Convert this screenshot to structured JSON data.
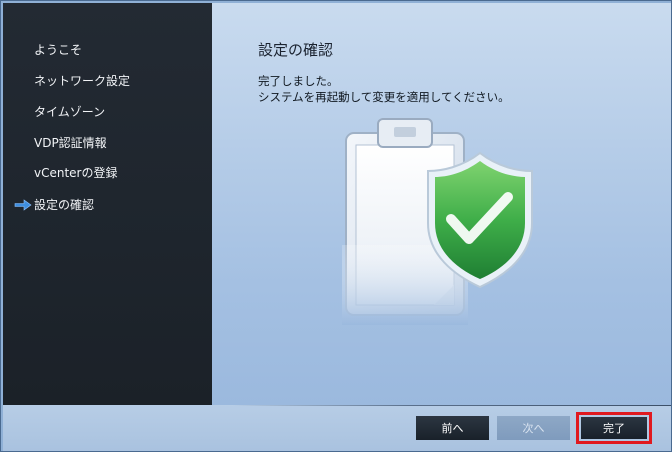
{
  "sidebar": {
    "items": [
      {
        "label": "ようこそ"
      },
      {
        "label": "ネットワーク設定"
      },
      {
        "label": "タイムゾーン"
      },
      {
        "label": "VDP認証情報"
      },
      {
        "label": "vCenterの登録"
      },
      {
        "label": "設定の確認",
        "current": true
      }
    ]
  },
  "main": {
    "title": "設定の確認",
    "message_line1": "完了しました。",
    "message_line2": "システムを再起動して変更を適用してください。"
  },
  "footer": {
    "back_label": "前へ",
    "next_label": "次へ",
    "finish_label": "完了"
  },
  "colors": {
    "sidebar_bg": "#1e252d",
    "highlight_border": "#e0191f",
    "current_arrow": "#3f8fe0",
    "shield": "#3fae49"
  },
  "icons": {
    "current_step": "arrow-right-icon",
    "illustration": "clipboard-check-shield-icon"
  }
}
